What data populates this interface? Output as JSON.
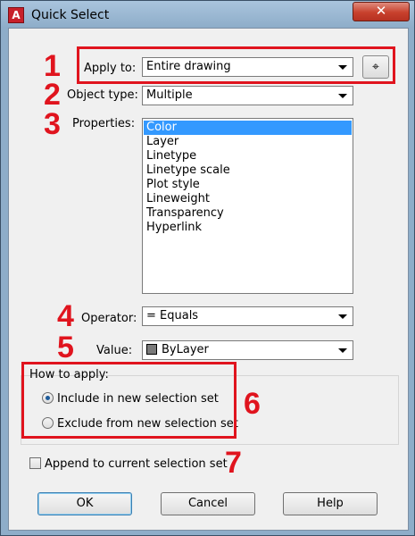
{
  "window": {
    "title": "Quick Select",
    "close_glyph": "✕"
  },
  "form": {
    "apply_to": {
      "label": "Apply to:",
      "value": "Entire drawing"
    },
    "object_type": {
      "label": "Object type:",
      "value": "Multiple"
    },
    "properties": {
      "label": "Properties:",
      "items": [
        "Color",
        "Layer",
        "Linetype",
        "Linetype scale",
        "Plot style",
        "Lineweight",
        "Transparency",
        "Hyperlink"
      ],
      "selected": "Color"
    },
    "operator": {
      "label": "Operator:",
      "value": "= Equals"
    },
    "value": {
      "label": "Value:",
      "value": "ByLayer",
      "swatch_color": "#7a7a7a"
    },
    "how_to_apply": {
      "label": "How to apply:",
      "include_label": "Include in new selection set",
      "exclude_label": "Exclude from new selection set",
      "selected": "include"
    },
    "append": {
      "label": "Append to current selection set",
      "checked": false
    }
  },
  "buttons": {
    "ok": "OK",
    "cancel": "Cancel",
    "help": "Help"
  },
  "annotations": {
    "color": "#e0141e",
    "numbers": [
      "1",
      "2",
      "3",
      "4",
      "5",
      "6",
      "7"
    ]
  },
  "icons": {
    "app": "autocad-a-icon",
    "pick": "select-objects-crosshair-icon",
    "close": "close-icon"
  }
}
